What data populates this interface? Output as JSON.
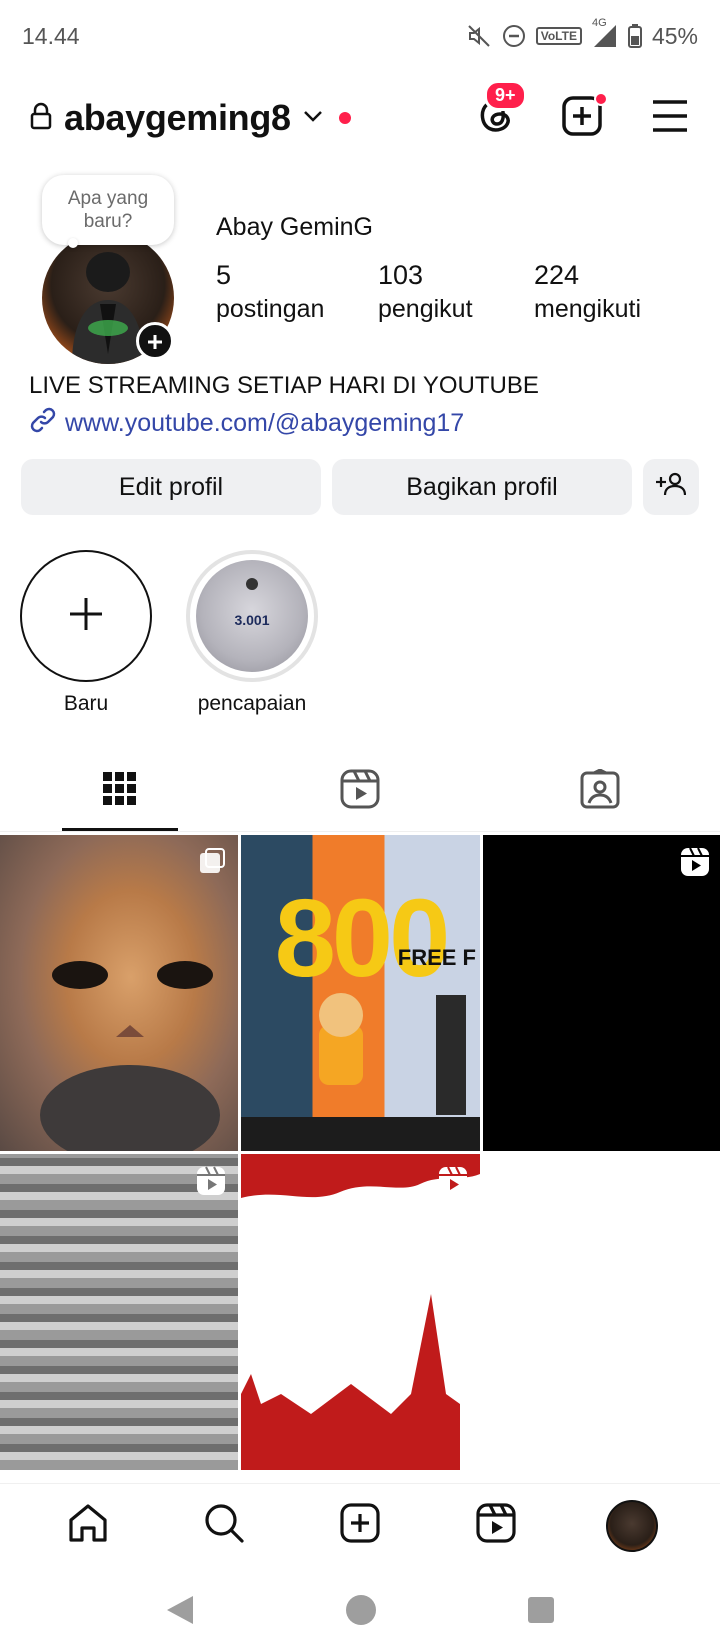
{
  "status_bar": {
    "time": "14.44",
    "network": "VoLTE",
    "signal_label": "4G",
    "battery": "45%",
    "icons": [
      "mute-icon",
      "dnd-icon",
      "volte-icon",
      "signal-icon",
      "battery-icon"
    ]
  },
  "header": {
    "username": "abaygeming8",
    "threads_badge": "9+",
    "icons": [
      "lock-icon",
      "chevron-down-icon",
      "threads-icon",
      "create-post-icon",
      "menu-icon"
    ]
  },
  "profile": {
    "note": "Apa yang baru?",
    "display_name": "Abay GeminG",
    "stats": [
      {
        "value": "5",
        "label": "postingan"
      },
      {
        "value": "103",
        "label": "pengikut"
      },
      {
        "value": "224",
        "label": "mengikuti"
      }
    ],
    "bio": "LIVE STREAMING SETIAP HARI DI YOUTUBE",
    "link": "www.youtube.com/@abaygeming17"
  },
  "buttons": {
    "edit": "Edit profil",
    "share": "Bagikan profil"
  },
  "highlights": [
    {
      "label": "Baru"
    },
    {
      "label": "pencapaian",
      "image_number": "3.001"
    }
  ],
  "tabs": [
    "grid-icon",
    "reels-icon",
    "tagged-icon"
  ],
  "posts": {
    "post2_big_text": "800",
    "post2_free": "FREE F"
  },
  "bottom_nav": [
    "home-icon",
    "search-icon",
    "create-icon",
    "reels-icon",
    "profile-avatar"
  ],
  "colors": {
    "accent_red": "#ff1f4b",
    "link_blue": "#3447a8",
    "button_bg": "#eff0f2"
  }
}
